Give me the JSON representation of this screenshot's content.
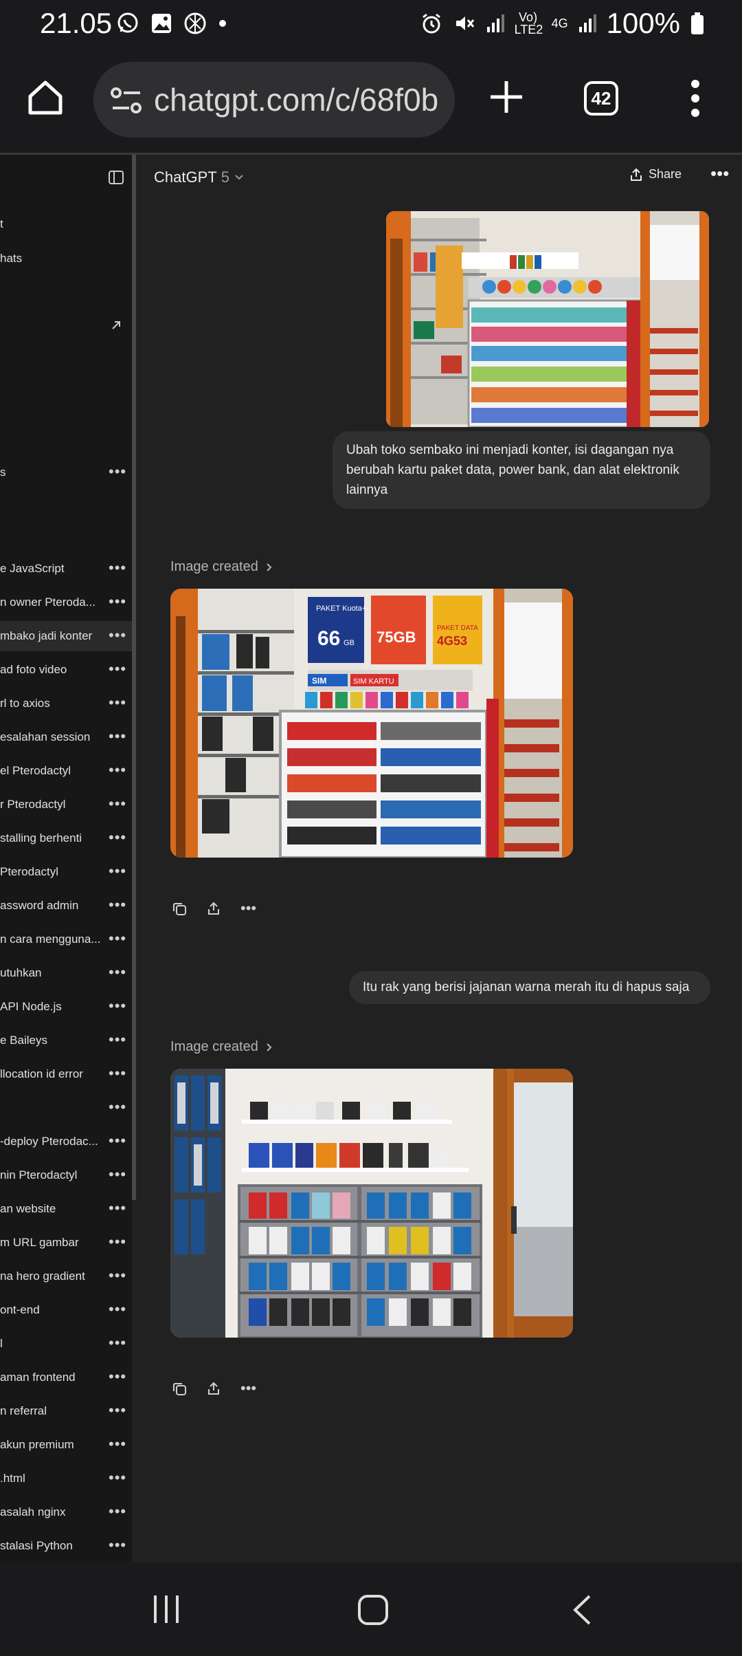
{
  "status_bar": {
    "time": "21.05",
    "battery": "100%",
    "network_top": "Vo) LTE2",
    "network_4g": "4G"
  },
  "browser": {
    "url": "chatgpt.com/c/68f0b",
    "tab_count": "42"
  },
  "header": {
    "model_name": "ChatGPT",
    "model_version": "5",
    "share_label": "Share"
  },
  "sidebar": {
    "top_items": [
      {
        "label": "t"
      },
      {
        "label": "hats"
      },
      {
        "label": "s"
      }
    ],
    "chats": [
      {
        "label": "e JavaScript"
      },
      {
        "label": "n owner Pteroda..."
      },
      {
        "label": "mbako jadi konter"
      },
      {
        "label": "ad foto video"
      },
      {
        "label": "rl to axios"
      },
      {
        "label": "esalahan session"
      },
      {
        "label": "el Pterodactyl"
      },
      {
        "label": "r Pterodactyl"
      },
      {
        "label": "stalling berhenti"
      },
      {
        "label": "Pterodactyl"
      },
      {
        "label": "assword admin"
      },
      {
        "label": "n cara mengguna..."
      },
      {
        "label": "utuhkan"
      },
      {
        "label": "API Node.js"
      },
      {
        "label": "e Baileys"
      },
      {
        "label": "llocation id error"
      },
      {
        "label": ""
      },
      {
        "label": "-deploy Pterodac..."
      },
      {
        "label": "nin Pterodactyl"
      },
      {
        "label": "an website"
      },
      {
        "label": "m URL gambar"
      },
      {
        "label": "na hero gradient"
      },
      {
        "label": "ont-end"
      },
      {
        "label": "l"
      },
      {
        "label": "aman frontend"
      },
      {
        "label": "n referral"
      },
      {
        "label": "akun premium"
      },
      {
        "label": ".html"
      },
      {
        "label": "asalah nginx"
      },
      {
        "label": "stalasi Python"
      }
    ]
  },
  "conversation": {
    "user_message_1": "Ubah toko sembako ini menjadi konter, isi dagangan nya berubah kartu paket data, power bank, dan alat elektronik lainnya",
    "image_created_1": "Image created",
    "user_message_2": "Itu rak yang berisi jajanan warna merah itu di hapus saja",
    "image_created_2": "Image created",
    "poster_1_top": "PAKET Kuota+",
    "poster_1_big": "66",
    "poster_1_unit": "GB",
    "poster_2_big": "75GB",
    "poster_3_top": "PAKET DATA",
    "poster_3_big": "4G53",
    "shelf_sign_1": "SIM",
    "shelf_sign_2": "SIM KARTU"
  },
  "colors": {
    "background": "#212121",
    "sidebar": "#171717",
    "bubble": "#303030",
    "status_bar": "#1a1a1c"
  }
}
